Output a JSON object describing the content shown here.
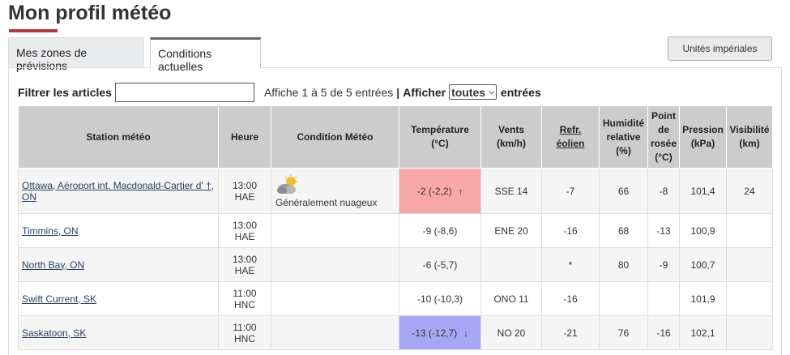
{
  "page": {
    "title": "Mon profil météo"
  },
  "tabs": [
    {
      "label": "Mes zones de prévisions"
    },
    {
      "label": "Conditions actuelles"
    }
  ],
  "units_button": "Unités impériales",
  "filter": {
    "label": "Filtrer les articles",
    "value": "",
    "entries_info": "Affiche 1 à 5 de 5 entrées",
    "separator": "|",
    "show_label": "Afficher",
    "show_value": "toutes",
    "entries_label": "entrées"
  },
  "table": {
    "headers": {
      "station": "Station météo",
      "time": "Heure",
      "condition": "Condition Météo",
      "temperature": "Température (°C)",
      "wind": "Vents (km/h)",
      "wind_chill": "Refr. éolien",
      "humidity": "Humidité relative (%)",
      "dewpoint": "Point de rosée (°C)",
      "pressure": "Pression (kPa)",
      "visibility": "Visibilité (km)"
    },
    "rows": [
      {
        "station": "Ottawa, Aéroport int. Macdonald-Cartier d' †, ON",
        "time_a": "13:00",
        "time_b": "HAE",
        "condition": "Généralement nuageux",
        "condition_icon": "partly-cloudy-icon",
        "temperature": "-2 (-2,2)",
        "trend": "↑",
        "wind": "SSE 14",
        "wind_chill": "-7",
        "humidity": "66",
        "dewpoint": "-8",
        "pressure": "101,4",
        "visibility": "24"
      },
      {
        "station": "Timmins, ON",
        "time_a": "13:00",
        "time_b": "HAE",
        "condition": "",
        "temperature": "-9 (-8,6)",
        "trend": "",
        "wind": "ENE 20",
        "wind_chill": "-16",
        "humidity": "68",
        "dewpoint": "-13",
        "pressure": "100,9",
        "visibility": ""
      },
      {
        "station": "North Bay, ON",
        "time_a": "13:00",
        "time_b": "HAE",
        "condition": "",
        "temperature": "-6 (-5,7)",
        "trend": "",
        "wind": "",
        "wind_chill": "*",
        "humidity": "80",
        "dewpoint": "-9",
        "pressure": "100,7",
        "visibility": ""
      },
      {
        "station": "Swift Current, SK",
        "time_a": "11:00",
        "time_b": "HNC",
        "condition": "",
        "temperature": "-10 (-10,3)",
        "trend": "",
        "wind": "ONO 11",
        "wind_chill": "-16",
        "humidity": "",
        "dewpoint": "",
        "pressure": "101,9",
        "visibility": ""
      },
      {
        "station": "Saskatoon, SK",
        "time_a": "11:00",
        "time_b": "HNC",
        "condition": "",
        "temperature": "-13 (-12,7)",
        "trend": "↓",
        "wind": "NO 20",
        "wind_chill": "-21",
        "humidity": "76",
        "dewpoint": "-16",
        "pressure": "102,1",
        "visibility": ""
      }
    ]
  },
  "colors": {
    "accent": "#af3c43",
    "temp_hot": "#f8a7a7",
    "temp_cold": "#a8a7f6",
    "link": "#284162"
  }
}
